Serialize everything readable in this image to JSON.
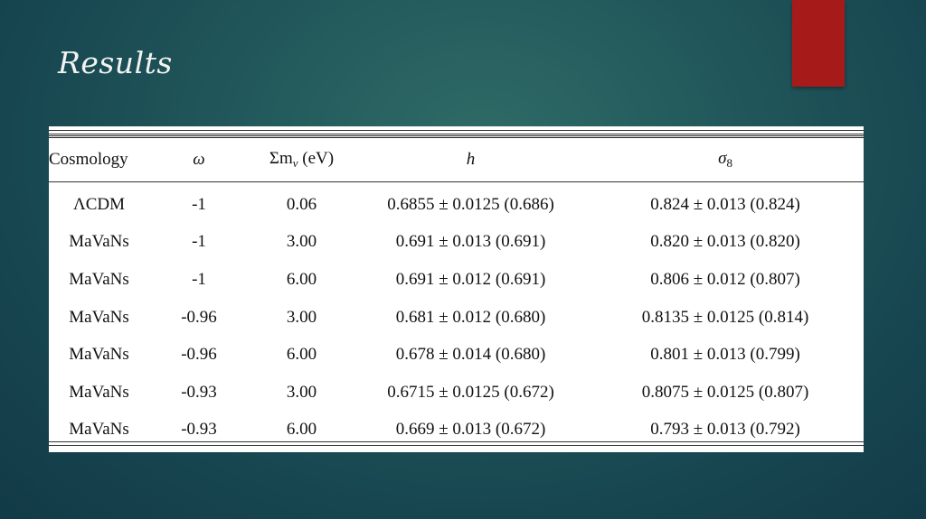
{
  "slide": {
    "title": "Results"
  },
  "table": {
    "headers": {
      "cosmology": "Cosmology",
      "omega": "ω",
      "mass_prefix": "Σm",
      "mass_sub": "ν",
      "mass_unit": " (eV)",
      "h": "h",
      "sigma": "σ",
      "sigma_sub": "8"
    },
    "rows": [
      {
        "cosmology": "ΛCDM",
        "omega": "-1",
        "mass": "0.06",
        "h": "0.6855 ± 0.0125 (0.686)",
        "sigma8": "0.824 ± 0.013 (0.824)"
      },
      {
        "cosmology": "MaVaNs",
        "omega": "-1",
        "mass": "3.00",
        "h": "0.691 ± 0.013 (0.691)",
        "sigma8": "0.820 ± 0.013 (0.820)"
      },
      {
        "cosmology": "MaVaNs",
        "omega": "-1",
        "mass": "6.00",
        "h": "0.691 ± 0.012 (0.691)",
        "sigma8": "0.806 ± 0.012 (0.807)"
      },
      {
        "cosmology": "MaVaNs",
        "omega": "-0.96",
        "mass": "3.00",
        "h": "0.681 ± 0.012 (0.680)",
        "sigma8": "0.8135 ± 0.0125 (0.814)"
      },
      {
        "cosmology": "MaVaNs",
        "omega": "-0.96",
        "mass": "6.00",
        "h": "0.678 ± 0.014 (0.680)",
        "sigma8": "0.801 ± 0.013 (0.799)"
      },
      {
        "cosmology": "MaVaNs",
        "omega": "-0.93",
        "mass": "3.00",
        "h": "0.6715 ± 0.0125 (0.672)",
        "sigma8": "0.8075 ± 0.0125 (0.807)"
      },
      {
        "cosmology": "MaVaNs",
        "omega": "-0.93",
        "mass": "6.00",
        "h": "0.669 ± 0.013 (0.672)",
        "sigma8": "0.793 ± 0.013 (0.792)"
      }
    ]
  },
  "colors": {
    "accent": "#a61a1a",
    "background": "#1f5558",
    "title": "#f2f2f2"
  }
}
